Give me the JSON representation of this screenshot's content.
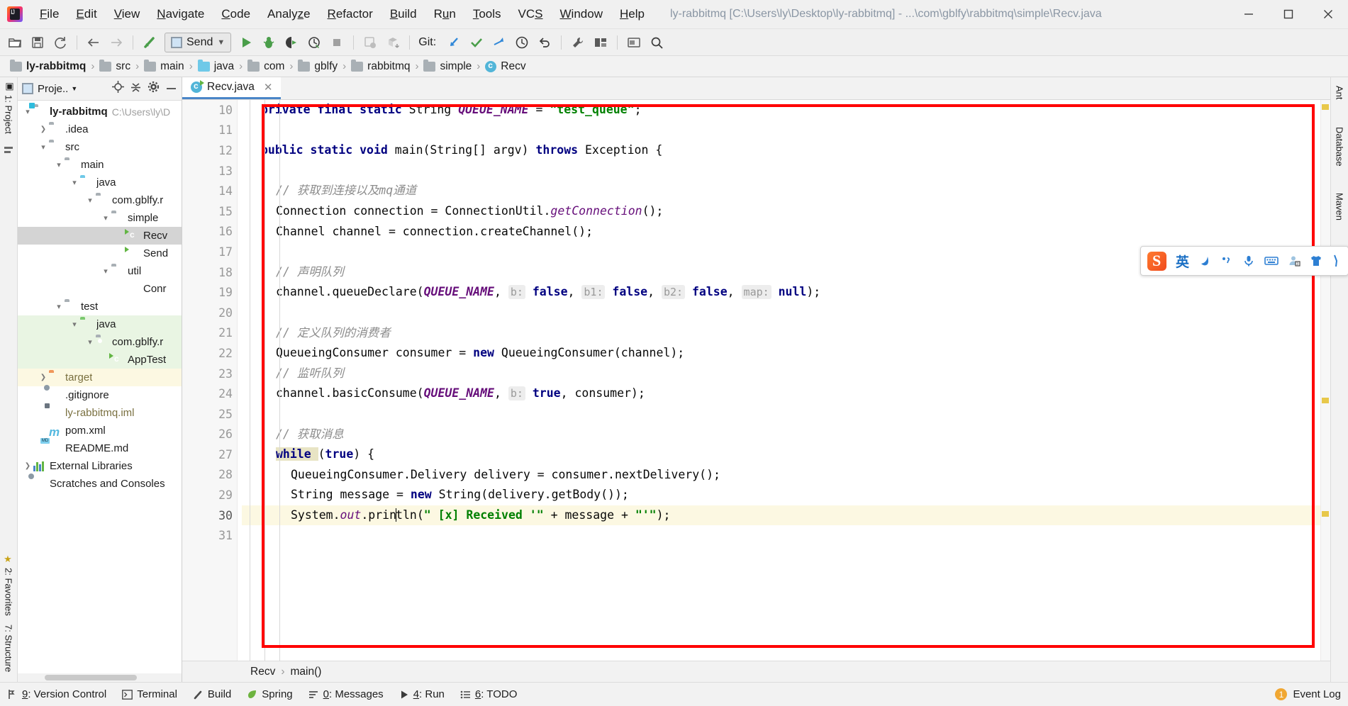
{
  "window": {
    "title": "ly-rabbitmq [C:\\Users\\ly\\Desktop\\ly-rabbitmq] - ...\\com\\gblfy\\rabbitmq\\simple\\Recv.java",
    "minimize": "—",
    "maximize": "❐",
    "close": "✕"
  },
  "menubar": {
    "items": [
      {
        "label": "File",
        "mnemonic": "F"
      },
      {
        "label": "Edit",
        "mnemonic": "E"
      },
      {
        "label": "View",
        "mnemonic": "V"
      },
      {
        "label": "Navigate",
        "mnemonic": "N"
      },
      {
        "label": "Code",
        "mnemonic": "C"
      },
      {
        "label": "Analyze",
        "mnemonic": "z"
      },
      {
        "label": "Refactor",
        "mnemonic": "R"
      },
      {
        "label": "Build",
        "mnemonic": "B"
      },
      {
        "label": "Run",
        "mnemonic": "u"
      },
      {
        "label": "Tools",
        "mnemonic": "T"
      },
      {
        "label": "VCS",
        "mnemonic": "S"
      },
      {
        "label": "Window",
        "mnemonic": "W"
      },
      {
        "label": "Help",
        "mnemonic": "H"
      }
    ]
  },
  "toolbar": {
    "run_config": "Send",
    "git_label": "Git:",
    "icons": [
      "open-folder-icon",
      "save-all-icon",
      "sync-icon",
      "back-arrow-icon",
      "forward-arrow-icon",
      "last-edit-location-icon"
    ]
  },
  "breadcrumb": {
    "items": [
      {
        "label": "ly-rabbitmq",
        "icon": "folder-icon",
        "bold": true
      },
      {
        "label": "src",
        "icon": "folder-icon",
        "bold": false
      },
      {
        "label": "main",
        "icon": "folder-icon",
        "bold": false
      },
      {
        "label": "java",
        "icon": "source-folder-icon",
        "bold": false
      },
      {
        "label": "com",
        "icon": "folder-icon",
        "bold": false
      },
      {
        "label": "gblfy",
        "icon": "folder-icon",
        "bold": false
      },
      {
        "label": "rabbitmq",
        "icon": "folder-icon",
        "bold": false
      },
      {
        "label": "simple",
        "icon": "folder-icon",
        "bold": false
      },
      {
        "label": "Recv",
        "icon": "java-class-icon",
        "bold": false
      }
    ],
    "separator": "›"
  },
  "left_rail": {
    "top_label": "1: Project",
    "bottom_labels": [
      "2: Favorites",
      "7: Structure"
    ]
  },
  "right_rail": {
    "labels": [
      "Ant",
      "Database",
      "Maven"
    ]
  },
  "project_panel": {
    "title": "Proje..",
    "header_icons": [
      "locate-icon",
      "collapse-all-icon",
      "settings-gear-icon",
      "hide-icon"
    ],
    "tree": [
      {
        "label": "ly-rabbitmq",
        "indent": 0,
        "arrow": "down",
        "icon": "project-folder-icon",
        "bold": true,
        "suffix": "C:\\Users\\ly\\D",
        "state": "normal"
      },
      {
        "label": ".idea",
        "indent": 1,
        "arrow": "right",
        "icon": "folder-icon",
        "bold": false,
        "suffix": "",
        "state": "normal"
      },
      {
        "label": "src",
        "indent": 1,
        "arrow": "down",
        "icon": "folder-icon",
        "bold": false,
        "suffix": "",
        "state": "normal"
      },
      {
        "label": "main",
        "indent": 2,
        "arrow": "down",
        "icon": "folder-icon",
        "bold": false,
        "suffix": "",
        "state": "normal"
      },
      {
        "label": "java",
        "indent": 3,
        "arrow": "down",
        "icon": "source-folder-icon",
        "bold": false,
        "suffix": "",
        "state": "normal"
      },
      {
        "label": "com.gblfy.r",
        "indent": 4,
        "arrow": "down",
        "icon": "package-icon",
        "bold": false,
        "suffix": "",
        "state": "normal"
      },
      {
        "label": "simple",
        "indent": 5,
        "arrow": "down",
        "icon": "package-icon",
        "bold": false,
        "suffix": "",
        "state": "normal"
      },
      {
        "label": "Recv",
        "indent": 6,
        "arrow": "none",
        "icon": "java-class-runnable-icon",
        "bold": false,
        "suffix": "",
        "state": "selected"
      },
      {
        "label": "Send",
        "indent": 6,
        "arrow": "none",
        "icon": "java-class-runnable-icon",
        "bold": false,
        "suffix": "",
        "state": "normal"
      },
      {
        "label": "util",
        "indent": 5,
        "arrow": "down",
        "icon": "package-icon",
        "bold": false,
        "suffix": "",
        "state": "normal"
      },
      {
        "label": "Conr",
        "indent": 6,
        "arrow": "none",
        "icon": "java-class-icon",
        "bold": false,
        "suffix": "",
        "state": "normal"
      },
      {
        "label": "test",
        "indent": 2,
        "arrow": "down",
        "icon": "folder-icon",
        "bold": false,
        "suffix": "",
        "state": "normal"
      },
      {
        "label": "java",
        "indent": 3,
        "arrow": "down",
        "icon": "test-source-folder-icon",
        "bold": false,
        "suffix": "",
        "state": "green"
      },
      {
        "label": "com.gblfy.r",
        "indent": 4,
        "arrow": "down",
        "icon": "package-icon",
        "bold": false,
        "suffix": "",
        "state": "green"
      },
      {
        "label": "AppTest",
        "indent": 5,
        "arrow": "none",
        "icon": "java-class-runnable-icon",
        "bold": false,
        "suffix": "",
        "state": "green"
      },
      {
        "label": "target",
        "indent": 1,
        "arrow": "right",
        "icon": "excluded-folder-icon",
        "bold": false,
        "suffix": "",
        "state": "yellow"
      },
      {
        "label": ".gitignore",
        "indent": 1,
        "arrow": "none",
        "icon": "gitignore-file-icon",
        "bold": false,
        "suffix": "",
        "state": "normal"
      },
      {
        "label": "ly-rabbitmq.iml",
        "indent": 1,
        "arrow": "none",
        "icon": "iml-file-icon",
        "bold": false,
        "suffix": "",
        "state": "normal"
      },
      {
        "label": "pom.xml",
        "indent": 1,
        "arrow": "none",
        "icon": "maven-file-icon",
        "bold": false,
        "suffix": "",
        "state": "normal"
      },
      {
        "label": "README.md",
        "indent": 1,
        "arrow": "none",
        "icon": "markdown-file-icon",
        "bold": false,
        "suffix": "",
        "state": "normal"
      },
      {
        "label": "External Libraries",
        "indent": 0,
        "arrow": "right",
        "icon": "libraries-icon",
        "bold": false,
        "suffix": "",
        "state": "normal"
      },
      {
        "label": "Scratches and Consoles",
        "indent": 0,
        "arrow": "none",
        "icon": "scratches-icon",
        "bold": false,
        "suffix": "",
        "state": "normal"
      }
    ]
  },
  "editor": {
    "tab": {
      "label": "Recv.java",
      "icon": "java-class-icon",
      "close": "✕"
    },
    "line_numbers": [
      "10",
      "11",
      "12",
      "13",
      "14",
      "15",
      "16",
      "17",
      "18",
      "19",
      "20",
      "21",
      "22",
      "23",
      "24",
      "25",
      "26",
      "27",
      "28",
      "29",
      "30",
      "31"
    ],
    "run_marker_line": "12",
    "breadcrumb_bottom": [
      "Recv",
      "main()"
    ],
    "breadcrumb_bottom_sep": "›",
    "lines": [
      {
        "n": "10",
        "indent": 1,
        "tokens": [
          {
            "t": "private ",
            "c": "kw"
          },
          {
            "t": "final ",
            "c": "kw"
          },
          {
            "t": "static ",
            "c": "kw"
          },
          {
            "t": "String ",
            "c": "plain"
          },
          {
            "t": "QUEUE_NAME",
            "c": "cst"
          },
          {
            "t": " = ",
            "c": "plain"
          },
          {
            "t": "\"test_queue\"",
            "c": "str"
          },
          {
            "t": ";",
            "c": "plain"
          }
        ]
      },
      {
        "n": "11",
        "indent": 1,
        "tokens": []
      },
      {
        "n": "12",
        "indent": 1,
        "tokens": [
          {
            "t": "public ",
            "c": "kw"
          },
          {
            "t": "static ",
            "c": "kw"
          },
          {
            "t": "void ",
            "c": "kw"
          },
          {
            "t": "main(String[] argv) ",
            "c": "plain"
          },
          {
            "t": "throws ",
            "c": "kw"
          },
          {
            "t": "Exception {",
            "c": "plain"
          }
        ]
      },
      {
        "n": "13",
        "indent": 2,
        "tokens": []
      },
      {
        "n": "14",
        "indent": 2,
        "tokens": [
          {
            "t": "// 获取到连接以及mq通道",
            "c": "cmt"
          }
        ]
      },
      {
        "n": "15",
        "indent": 2,
        "tokens": [
          {
            "t": "Connection connection = ConnectionUtil.",
            "c": "plain"
          },
          {
            "t": "getConnection",
            "c": "mth"
          },
          {
            "t": "();",
            "c": "plain"
          }
        ]
      },
      {
        "n": "16",
        "indent": 2,
        "tokens": [
          {
            "t": "Channel channel = connection.createChannel();",
            "c": "plain"
          }
        ]
      },
      {
        "n": "17",
        "indent": 2,
        "tokens": []
      },
      {
        "n": "18",
        "indent": 2,
        "tokens": [
          {
            "t": "// 声明队列",
            "c": "cmt"
          }
        ]
      },
      {
        "n": "19",
        "indent": 2,
        "tokens": [
          {
            "t": "channel.queueDeclare(",
            "c": "plain"
          },
          {
            "t": "QUEUE_NAME",
            "c": "cst"
          },
          {
            "t": ", ",
            "c": "plain"
          },
          {
            "t": "b:",
            "c": "hint"
          },
          {
            "t": " ",
            "c": "plain"
          },
          {
            "t": "false",
            "c": "kw"
          },
          {
            "t": ", ",
            "c": "plain"
          },
          {
            "t": "b1:",
            "c": "hint"
          },
          {
            "t": " ",
            "c": "plain"
          },
          {
            "t": "false",
            "c": "kw"
          },
          {
            "t": ", ",
            "c": "plain"
          },
          {
            "t": "b2:",
            "c": "hint"
          },
          {
            "t": " ",
            "c": "plain"
          },
          {
            "t": "false",
            "c": "kw"
          },
          {
            "t": ", ",
            "c": "plain"
          },
          {
            "t": "map:",
            "c": "hint"
          },
          {
            "t": " ",
            "c": "plain"
          },
          {
            "t": "null",
            "c": "kw"
          },
          {
            "t": ");",
            "c": "plain"
          }
        ]
      },
      {
        "n": "20",
        "indent": 2,
        "tokens": []
      },
      {
        "n": "21",
        "indent": 2,
        "tokens": [
          {
            "t": "// 定义队列的消费者",
            "c": "cmt"
          }
        ]
      },
      {
        "n": "22",
        "indent": 2,
        "tokens": [
          {
            "t": "QueueingConsumer consumer = ",
            "c": "plain"
          },
          {
            "t": "new ",
            "c": "kw"
          },
          {
            "t": "QueueingConsumer(channel);",
            "c": "plain"
          }
        ]
      },
      {
        "n": "23",
        "indent": 2,
        "tokens": [
          {
            "t": "// 监听队列",
            "c": "cmt"
          }
        ]
      },
      {
        "n": "24",
        "indent": 2,
        "tokens": [
          {
            "t": "channel.basicConsume(",
            "c": "plain"
          },
          {
            "t": "QUEUE_NAME",
            "c": "cst"
          },
          {
            "t": ", ",
            "c": "plain"
          },
          {
            "t": "b:",
            "c": "hint"
          },
          {
            "t": " ",
            "c": "plain"
          },
          {
            "t": "true",
            "c": "kw"
          },
          {
            "t": ", consumer);",
            "c": "plain"
          }
        ]
      },
      {
        "n": "25",
        "indent": 2,
        "tokens": []
      },
      {
        "n": "26",
        "indent": 2,
        "tokens": [
          {
            "t": "// 获取消息",
            "c": "cmt"
          }
        ]
      },
      {
        "n": "27",
        "indent": 2,
        "tokens": [
          {
            "t": "while ",
            "c": "kw-hl"
          },
          {
            "t": "(",
            "c": "plain"
          },
          {
            "t": "true",
            "c": "kw"
          },
          {
            "t": ") {",
            "c": "plain"
          }
        ]
      },
      {
        "n": "28",
        "indent": 3,
        "tokens": [
          {
            "t": "QueueingConsumer.Delivery delivery = consumer.nextDelivery();",
            "c": "plain"
          }
        ]
      },
      {
        "n": "29",
        "indent": 3,
        "tokens": [
          {
            "t": "String message = ",
            "c": "plain"
          },
          {
            "t": "new ",
            "c": "kw"
          },
          {
            "t": "String(delivery.getBody());",
            "c": "plain"
          }
        ]
      },
      {
        "n": "30",
        "indent": 3,
        "highlight": true,
        "tokens": [
          {
            "t": "System.",
            "c": "plain"
          },
          {
            "t": "out",
            "c": "fld"
          },
          {
            "t": ".prin",
            "c": "plain"
          },
          {
            "t": "CARET",
            "c": "caret"
          },
          {
            "t": "tln(",
            "c": "plain"
          },
          {
            "t": "\" [x] Received '\"",
            "c": "str"
          },
          {
            "t": " + message + ",
            "c": "plain"
          },
          {
            "t": "\"'\"",
            "c": "str"
          },
          {
            "t": ");",
            "c": "plain"
          }
        ]
      },
      {
        "n": "31",
        "indent": 3,
        "tokens": []
      }
    ]
  },
  "ime": {
    "logo": "sogou-logo",
    "mode": "英",
    "icons": [
      "moon-icon",
      "punctuation-icon",
      "microphone-icon",
      "keyboard-icon",
      "user-icon",
      "skin-icon",
      "tools-icon"
    ]
  },
  "statusbar": {
    "items": [
      {
        "label": "9: Version Control",
        "mnemonic": "9",
        "icon": "version-control-icon"
      },
      {
        "label": "Terminal",
        "mnemonic": "",
        "icon": "terminal-icon"
      },
      {
        "label": "Build",
        "mnemonic": "",
        "icon": "build-hammer-icon"
      },
      {
        "label": "Spring",
        "mnemonic": "",
        "icon": "spring-leaf-icon"
      },
      {
        "label": "0: Messages",
        "mnemonic": "0",
        "icon": "messages-icon"
      },
      {
        "label": "4: Run",
        "mnemonic": "4",
        "icon": "run-play-icon"
      },
      {
        "label": "6: TODO",
        "mnemonic": "6",
        "icon": "todo-list-icon"
      }
    ],
    "event_log": "Event Log",
    "event_badge": "1"
  }
}
